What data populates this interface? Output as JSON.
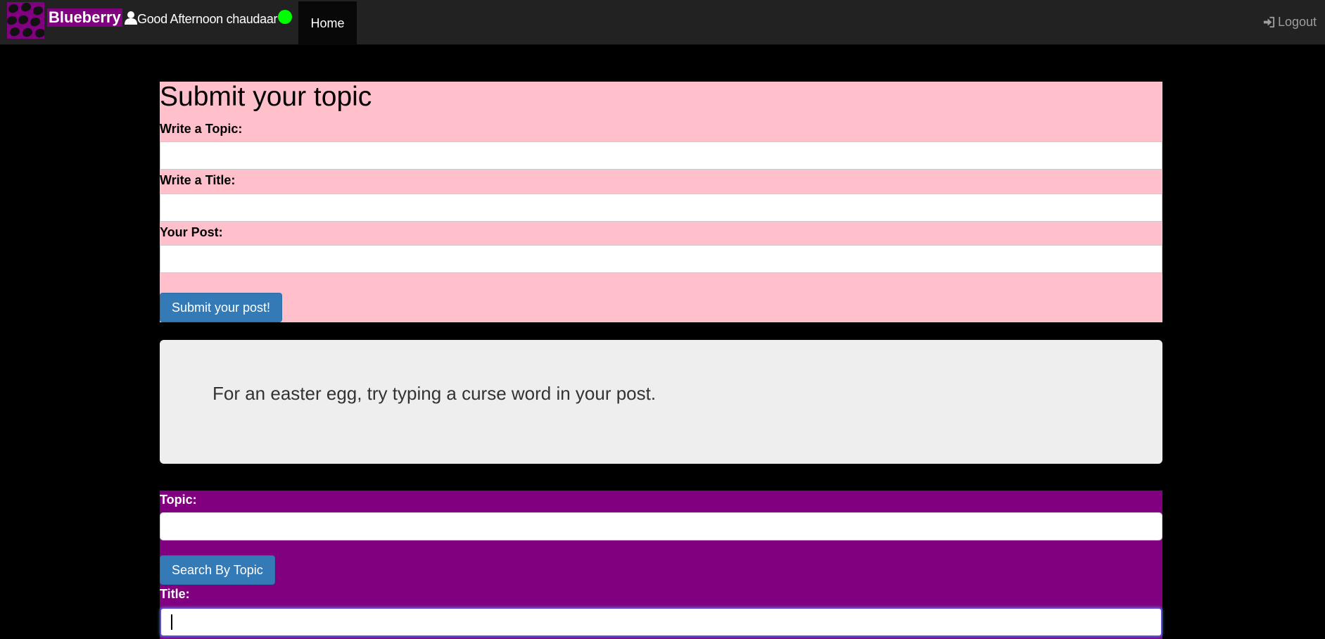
{
  "navbar": {
    "brand": "Blueberry",
    "greeting": "Good Afternoon chaudaar",
    "home_label": "Home",
    "logout_label": "Logout",
    "online_status_color": "#00ff00"
  },
  "submit_form": {
    "title": "Submit your topic",
    "topic_label": "Write a Topic:",
    "topic_value": "",
    "title_label": "Write a Title:",
    "title_value": "",
    "post_label": "Your Post:",
    "post_value": "",
    "submit_label": "Submit your post!"
  },
  "jumbotron": {
    "text": "For an easter egg, try typing a curse word in your post."
  },
  "search_form": {
    "topic_label": "Topic:",
    "topic_value": "",
    "search_topic_label": "Search By Topic",
    "title_label": "Title:",
    "title_value": ""
  },
  "colors": {
    "brand_purple": "#800080",
    "form_pink": "#ffc0cb",
    "primary_blue": "#337ab7",
    "jumbotron_gray": "#eeeeee",
    "navbar_dark": "#222222"
  },
  "icons": {
    "user": "user-icon",
    "logout": "sign-in-icon",
    "logo": "blueberry-logo"
  }
}
